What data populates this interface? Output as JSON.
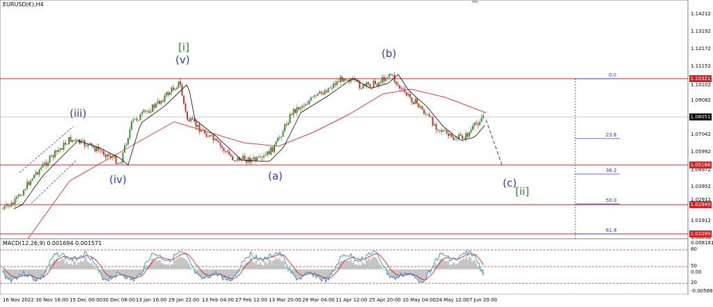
{
  "chart_title": "EURUSD(€),H4",
  "macd_title": "MACD(12,26,9) 0.001694 0.001571",
  "price_axis": [
    "1.14212",
    "1.13192",
    "1.12172",
    "1.11152",
    "1.10102",
    "1.09082",
    "1.07042",
    "1.05992",
    "1.04972",
    "1.03952",
    "1.02912",
    "1.01912",
    "1.00892"
  ],
  "price_tags": {
    "top_line": "1.10321",
    "current": "1.08051",
    "mid_line": "1.05168",
    "lower_line": "1.02849",
    "bottom_line": "1.01099"
  },
  "macd_axis": [
    "0.008181",
    "80",
    "50",
    "0.00",
    "20",
    "-0.005683"
  ],
  "time_axis": [
    "16 Nov 2022",
    "30 Nov 16:00",
    "15 Dec 00:00",
    "30 Dec 08:00",
    "13 Jan 16:00",
    "29 Jan 22:00",
    "13 Feb 04:00",
    "27 Feb 12:00",
    "13 Mar 20:00",
    "28 Mar 04:00",
    "11 Apr 12:00",
    "25 Apr 20:00",
    "10 May 04:00",
    "24 May 12:00",
    "7 Jun 20:00"
  ],
  "wave_labels": {
    "iii": "(iii)",
    "iv": "(iv)",
    "i_green": "[i]",
    "v": "(v)",
    "a": "(a)",
    "b": "(b)",
    "c": "(c)",
    "ii_green": "[ii]"
  },
  "fib_levels": [
    "0.0",
    "23.6",
    "38.2",
    "50.0",
    "61.8"
  ],
  "colors": {
    "bull": "#1d8a1d",
    "bear": "#c21c1c",
    "ma_black": "#000000",
    "ma_red": "#e03a3a",
    "wave_blue": "#2a35c7",
    "macd_blue": "#2a8ad8",
    "macd_hist": "#b8b8b8"
  }
}
